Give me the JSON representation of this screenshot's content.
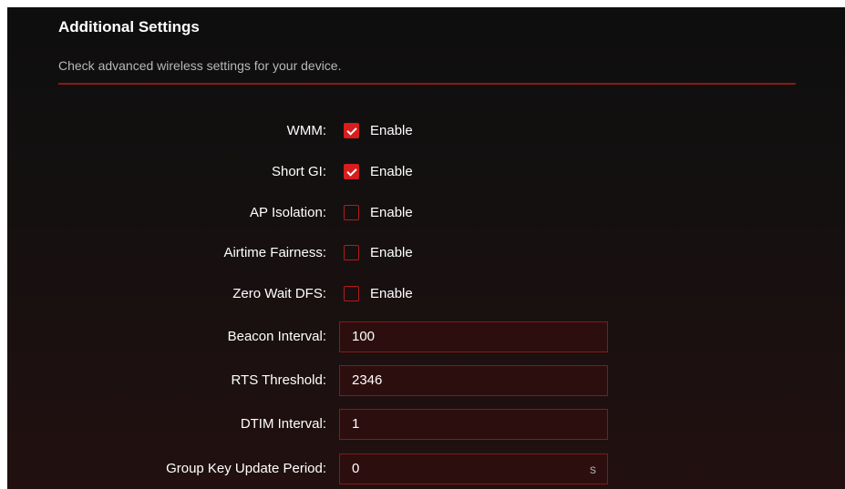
{
  "header": {
    "title": "Additional Settings",
    "subtitle": "Check advanced wireless settings for your device."
  },
  "checkbox_rows": [
    {
      "label": "WMM:",
      "option": "Enable",
      "checked": true
    },
    {
      "label": "Short GI:",
      "option": "Enable",
      "checked": true
    },
    {
      "label": "AP Isolation:",
      "option": "Enable",
      "checked": false
    },
    {
      "label": "Airtime Fairness:",
      "option": "Enable",
      "checked": false
    },
    {
      "label": "Zero Wait DFS:",
      "option": "Enable",
      "checked": false
    }
  ],
  "input_rows": [
    {
      "label": "Beacon Interval:",
      "value": "100"
    },
    {
      "label": "RTS Threshold:",
      "value": "2346"
    },
    {
      "label": "DTIM Interval:",
      "value": "1"
    },
    {
      "label": "Group Key Update Period:",
      "value": "0",
      "unit": "s"
    }
  ],
  "colors": {
    "accent": "#d71d1d",
    "divider": "#8e1616",
    "input_border": "#8a1717",
    "input_bg": "#2d0e0e"
  }
}
